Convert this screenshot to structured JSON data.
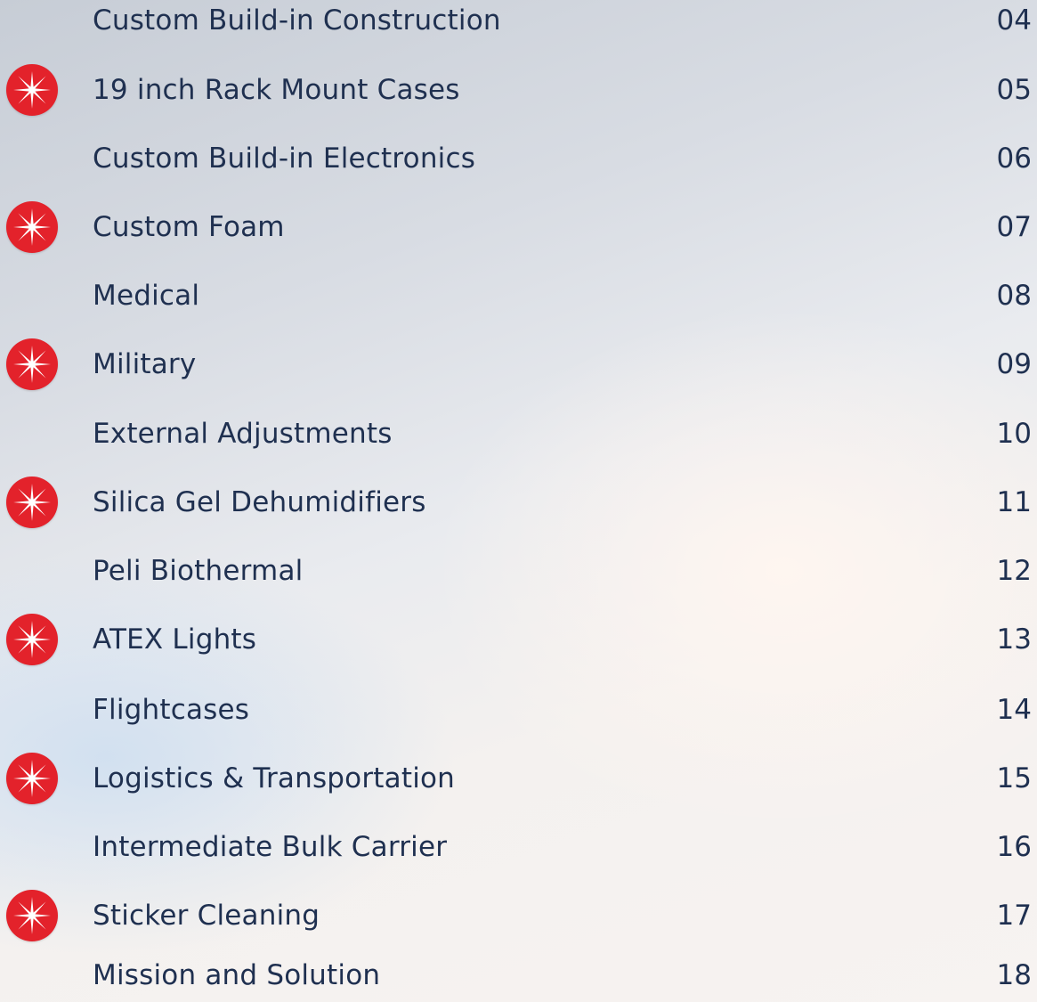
{
  "toc": {
    "entries": [
      {
        "title": "Custom Build-in Construction",
        "page": "04",
        "star": false
      },
      {
        "title": "19 inch Rack Mount Cases",
        "page": "05",
        "star": true
      },
      {
        "title": "Custom Build-in Electronics",
        "page": "06",
        "star": false
      },
      {
        "title": "Custom Foam",
        "page": "07",
        "star": true
      },
      {
        "title": "Medical",
        "page": "08",
        "star": false
      },
      {
        "title": "Military",
        "page": "09",
        "star": true
      },
      {
        "title": "External Adjustments",
        "page": "10",
        "star": false
      },
      {
        "title": "Silica Gel Dehumidifiers",
        "page": "11",
        "star": true
      },
      {
        "title": "Peli Biothermal",
        "page": "12",
        "star": false
      },
      {
        "title": "ATEX Lights",
        "page": "13",
        "star": true
      },
      {
        "title": "Flightcases",
        "page": "14",
        "star": false
      },
      {
        "title": "Logistics & Transportation",
        "page": "15",
        "star": true
      },
      {
        "title": "Intermediate Bulk Carrier",
        "page": "16",
        "star": false
      },
      {
        "title": "Sticker Cleaning",
        "page": "17",
        "star": true
      },
      {
        "title": "Mission and Solution",
        "page": "18",
        "star": false
      }
    ]
  },
  "colors": {
    "text": "#1f3050",
    "badge": "#e3222b"
  },
  "icons": {
    "badge": "red-star-badge-icon"
  }
}
